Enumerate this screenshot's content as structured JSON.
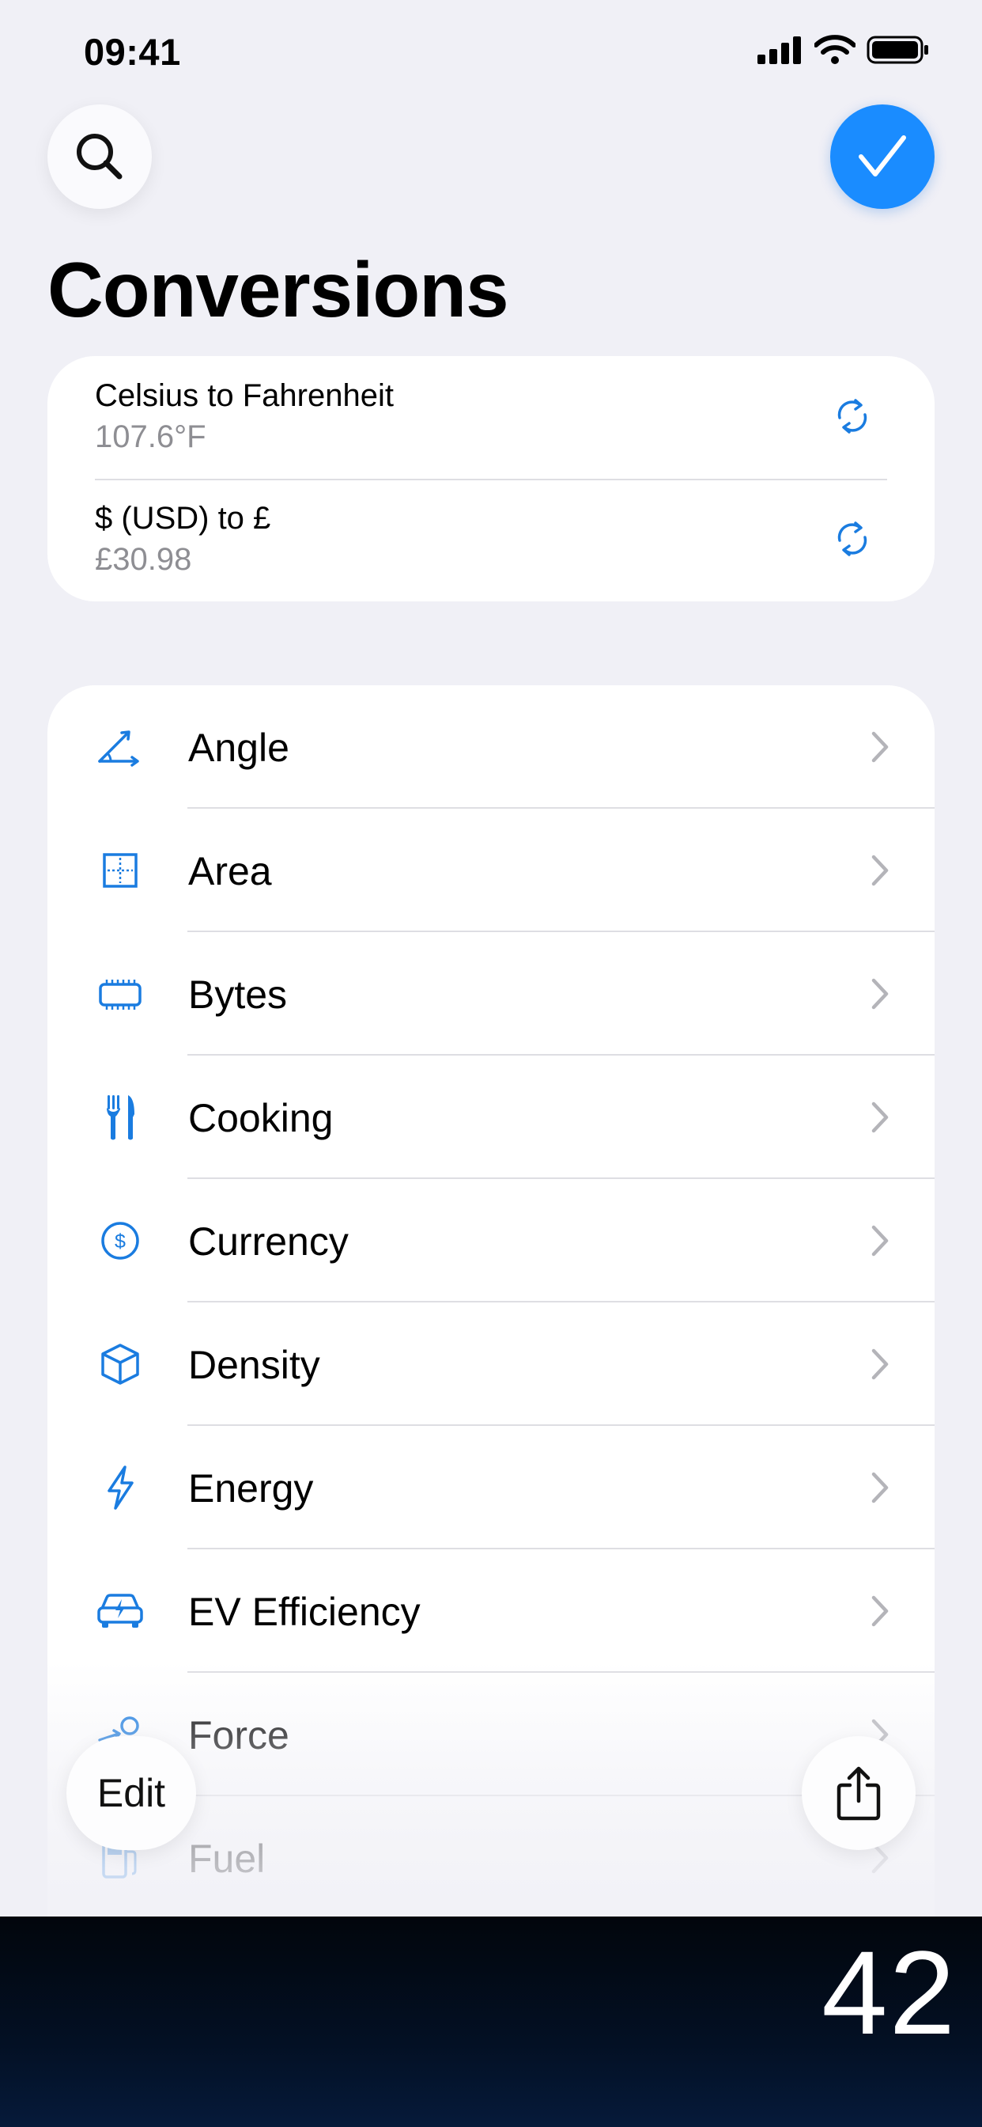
{
  "status_bar": {
    "time": "09:41"
  },
  "header": {
    "title": "Conversions",
    "search_icon": "search-icon",
    "done_icon": "checkmark-icon"
  },
  "recent": [
    {
      "title": "Celsius to Fahrenheit",
      "value": "107.6°F",
      "icon": "refresh-icon"
    },
    {
      "title": "$ (USD) to £",
      "value": "£30.98",
      "icon": "refresh-icon"
    }
  ],
  "categories": [
    {
      "label": "Angle",
      "icon": "angle-icon"
    },
    {
      "label": "Area",
      "icon": "area-icon"
    },
    {
      "label": "Bytes",
      "icon": "memory-chip-icon"
    },
    {
      "label": "Cooking",
      "icon": "fork-knife-icon"
    },
    {
      "label": "Currency",
      "icon": "dollar-circle-icon"
    },
    {
      "label": "Density",
      "icon": "cube-icon"
    },
    {
      "label": "Energy",
      "icon": "bolt-icon"
    },
    {
      "label": "EV Efficiency",
      "icon": "ev-car-icon"
    },
    {
      "label": "Force",
      "icon": "force-icon"
    },
    {
      "label": "Fuel",
      "icon": "fuel-pump-icon"
    }
  ],
  "toolbar": {
    "edit_label": "Edit",
    "share_icon": "share-icon"
  },
  "footer": {
    "number": "42"
  },
  "colors": {
    "accent": "#1a7ce0",
    "done_button": "#1a8cff",
    "background": "#f0f0f6"
  }
}
